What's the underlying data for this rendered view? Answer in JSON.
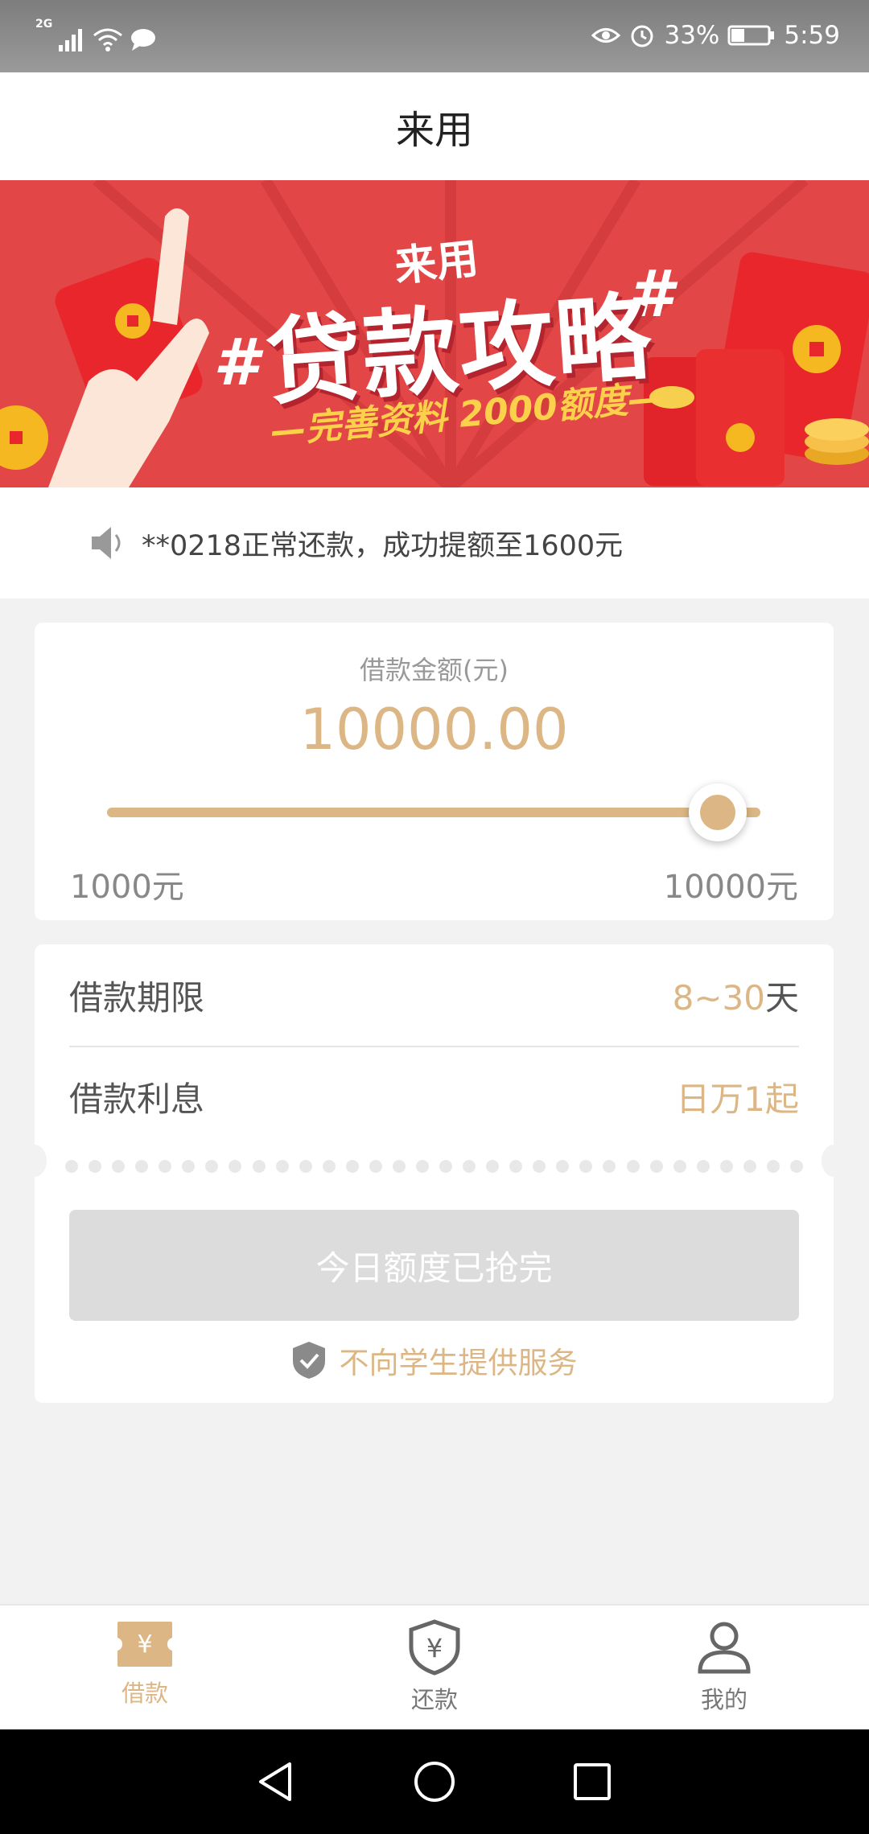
{
  "status_bar": {
    "network": "2G",
    "battery": "33%",
    "time": "5:59"
  },
  "header": {
    "title": "来用"
  },
  "banner": {
    "brand": "来用",
    "title": "贷款攻略",
    "hash_left": "#",
    "hash_right": "#",
    "subtitle": "—完善资料 2000额度—"
  },
  "notice": {
    "text": "**0218正常还款，成功提额至1600元"
  },
  "loan": {
    "amount_label": "借款金额(元)",
    "amount_value": "10000.00",
    "slider_level": 1.0,
    "min_label": "1000元",
    "max_label": "10000元"
  },
  "terms": {
    "period_label": "借款期限",
    "period_value": "8~30",
    "period_unit": "天",
    "interest_label": "借款利息",
    "interest_value": "日万1起"
  },
  "apply_button": {
    "label": "今日额度已抢完"
  },
  "student_note": {
    "text": "不向学生提供服务"
  },
  "tabs": [
    {
      "label": "借款",
      "icon": "loan-ticket-icon",
      "active": true
    },
    {
      "label": "还款",
      "icon": "repay-shield-icon",
      "active": false
    },
    {
      "label": "我的",
      "icon": "user-icon",
      "active": false
    }
  ],
  "colors": {
    "accent": "#dcb785",
    "banner_red": "#e34646",
    "disabled_button": "#dcdcdc"
  }
}
